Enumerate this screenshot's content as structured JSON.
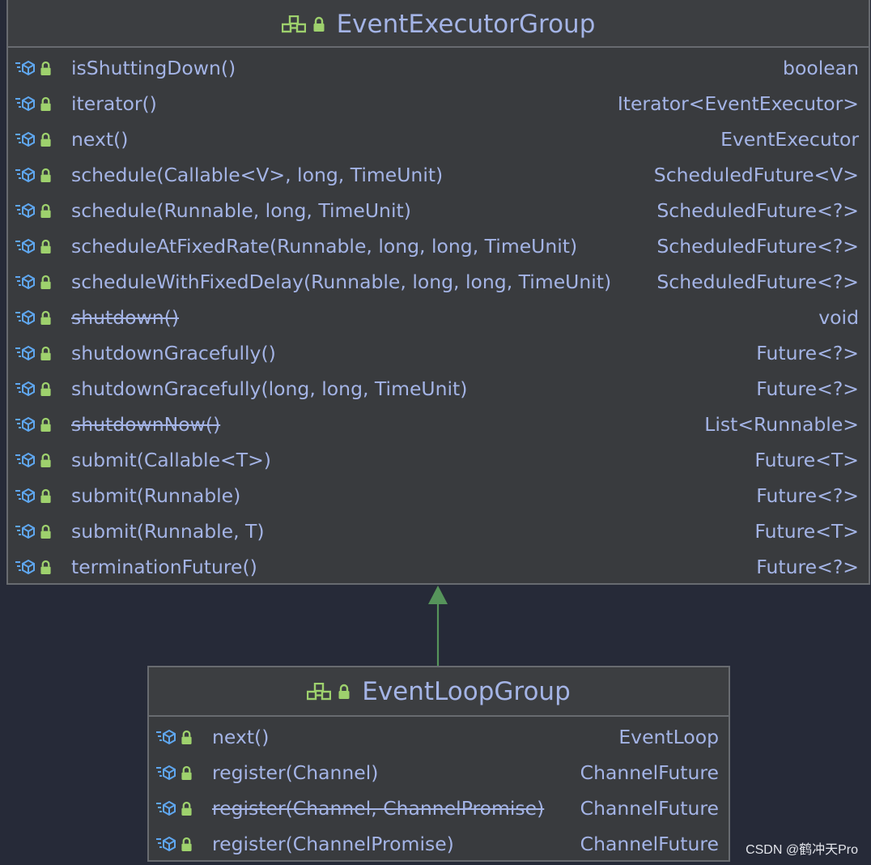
{
  "diagram": {
    "classes": [
      {
        "id": "event-executor-group",
        "title": "EventExecutorGroup",
        "icons": [
          "interface-icon",
          "lock-icon"
        ],
        "methods": [
          {
            "name": "isShuttingDown()",
            "return_type": "boolean",
            "deprecated": false
          },
          {
            "name": "iterator()",
            "return_type": "Iterator<EventExecutor>",
            "deprecated": false
          },
          {
            "name": "next()",
            "return_type": "EventExecutor",
            "deprecated": false
          },
          {
            "name": "schedule(Callable<V>, long, TimeUnit)",
            "return_type": "ScheduledFuture<V>",
            "deprecated": false
          },
          {
            "name": "schedule(Runnable, long, TimeUnit)",
            "return_type": "ScheduledFuture<?>",
            "deprecated": false
          },
          {
            "name": "scheduleAtFixedRate(Runnable, long, long, TimeUnit)",
            "return_type": "ScheduledFuture<?>",
            "deprecated": false
          },
          {
            "name": "scheduleWithFixedDelay(Runnable, long, long, TimeUnit)",
            "return_type": "ScheduledFuture<?>",
            "deprecated": false
          },
          {
            "name": "shutdown()",
            "return_type": "void",
            "deprecated": true
          },
          {
            "name": "shutdownGracefully()",
            "return_type": "Future<?>",
            "deprecated": false
          },
          {
            "name": "shutdownGracefully(long, long, TimeUnit)",
            "return_type": "Future<?>",
            "deprecated": false
          },
          {
            "name": "shutdownNow()",
            "return_type": "List<Runnable>",
            "deprecated": true
          },
          {
            "name": "submit(Callable<T>)",
            "return_type": "Future<T>",
            "deprecated": false
          },
          {
            "name": "submit(Runnable)",
            "return_type": "Future<?>",
            "deprecated": false
          },
          {
            "name": "submit(Runnable, T)",
            "return_type": "Future<T>",
            "deprecated": false
          },
          {
            "name": "terminationFuture()",
            "return_type": "Future<?>",
            "deprecated": false
          }
        ]
      },
      {
        "id": "event-loop-group",
        "title": "EventLoopGroup",
        "icons": [
          "interface-icon",
          "lock-icon"
        ],
        "methods": [
          {
            "name": "next()",
            "return_type": "EventLoop",
            "deprecated": false
          },
          {
            "name": "register(Channel)",
            "return_type": "ChannelFuture",
            "deprecated": false
          },
          {
            "name": "register(Channel, ChannelPromise)",
            "return_type": "ChannelFuture",
            "deprecated": true
          },
          {
            "name": "register(ChannelPromise)",
            "return_type": "ChannelFuture",
            "deprecated": false
          }
        ]
      }
    ],
    "relations": [
      {
        "from": "event-loop-group",
        "to": "event-executor-group",
        "type": "extends"
      }
    ],
    "row_icons": [
      "method-icon",
      "lock-icon"
    ],
    "colors": {
      "background": "#262a38",
      "box_fill": "#393b3e",
      "box_border": "#686b70",
      "text": "#a4b4e6",
      "icon_blue": "#5fa7f0",
      "icon_green": "#9ed16d",
      "arrow": "#56945b"
    }
  },
  "watermark": "CSDN @鹤冲天Pro"
}
